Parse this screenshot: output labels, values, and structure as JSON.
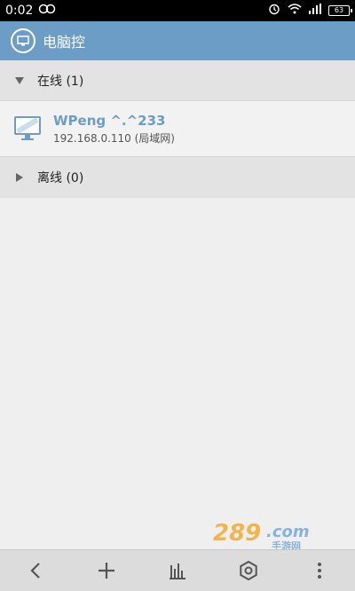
{
  "status_bar": {
    "time": "0:02",
    "battery": "63",
    "icons": [
      "infinity-icon",
      "alarm-icon",
      "wifi-icon",
      "signal-icon",
      "battery-icon"
    ]
  },
  "header": {
    "title": "电脑控",
    "icon": "monitor-circle-icon",
    "background": "#6b9dc7"
  },
  "groups": [
    {
      "label": "在线 (1)",
      "expanded": true,
      "devices": [
        {
          "name": "WPeng ^.^233",
          "address": "192.168.0.110 (局域网)",
          "icon": "monitor-icon"
        }
      ]
    },
    {
      "label": "离线 (0)",
      "expanded": false,
      "devices": []
    }
  ],
  "bottom_bar": {
    "items": [
      "back-icon",
      "add-icon",
      "chart-icon",
      "settings-icon",
      "more-icon"
    ]
  },
  "watermark": {
    "text": "289.com",
    "subtext": "手游网"
  },
  "colors": {
    "accent": "#6b9dc7",
    "group_bg": "#e3e3e3",
    "page_bg": "#efefef"
  }
}
